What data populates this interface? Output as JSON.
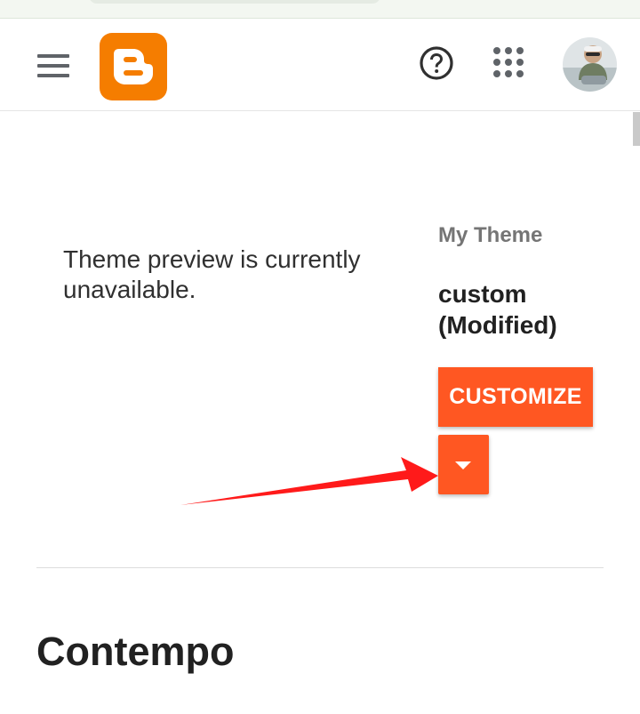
{
  "colors": {
    "accent": "#ff5722",
    "blogger_orange": "#f57d00",
    "annotation_red": "#ff1a1a"
  },
  "header": {
    "menu_icon": "hamburger-menu-icon",
    "logo_icon": "blogger-logo-icon",
    "help_icon": "help-circle-icon",
    "apps_icon": "apps-grid-icon",
    "avatar_icon": "user-avatar"
  },
  "preview": {
    "message": "Theme preview is currently unavailable."
  },
  "theme": {
    "label": "My Theme",
    "name": "custom (Modified)",
    "customize_label": "CUSTOMIZE",
    "dropdown_icon": "caret-down-icon"
  },
  "section": {
    "title": "Contempo"
  }
}
